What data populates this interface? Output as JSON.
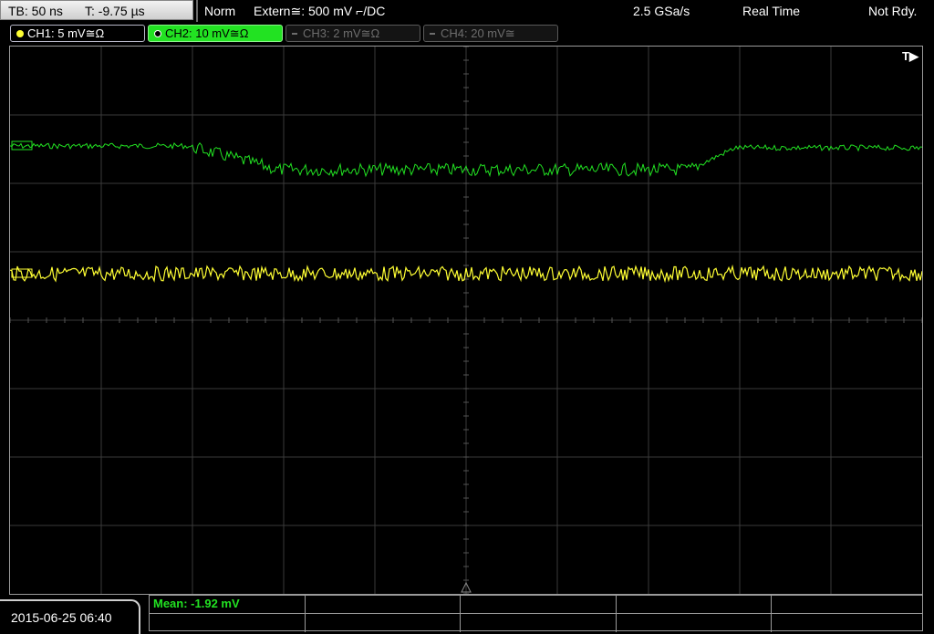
{
  "status": {
    "tb": "TB: 50 ns",
    "t": "T: -9.75 µs",
    "mode": "Norm",
    "trigger": "Extern≅: 500 mV ⌐/DC",
    "sample_rate": "2.5 GSa/s",
    "acquisition": "Real Time",
    "ready": "Not Rdy."
  },
  "channels": [
    {
      "label": "CH1: 5 mV≅Ω",
      "color": "#ffff33",
      "active": true
    },
    {
      "label": "CH2: 10 mV≅Ω",
      "color": "#22e222",
      "active": true
    },
    {
      "label": "CH3: 2 mV≅Ω",
      "color": "#6d6d6d",
      "active": false
    },
    {
      "label": "CH4: 20 mV≅",
      "color": "#6d6d6d",
      "active": false
    }
  ],
  "screen": {
    "trigger_marker": "T▶",
    "ch1_marker": "1",
    "ch2_marker": "2",
    "grid_color": "#3a3a3a"
  },
  "footer": {
    "datetime": "2015-06-25 06:40",
    "measurement": "Mean: -1.92 mV"
  },
  "colors": {
    "ch1": "#ffff33",
    "ch2": "#22e222"
  }
}
